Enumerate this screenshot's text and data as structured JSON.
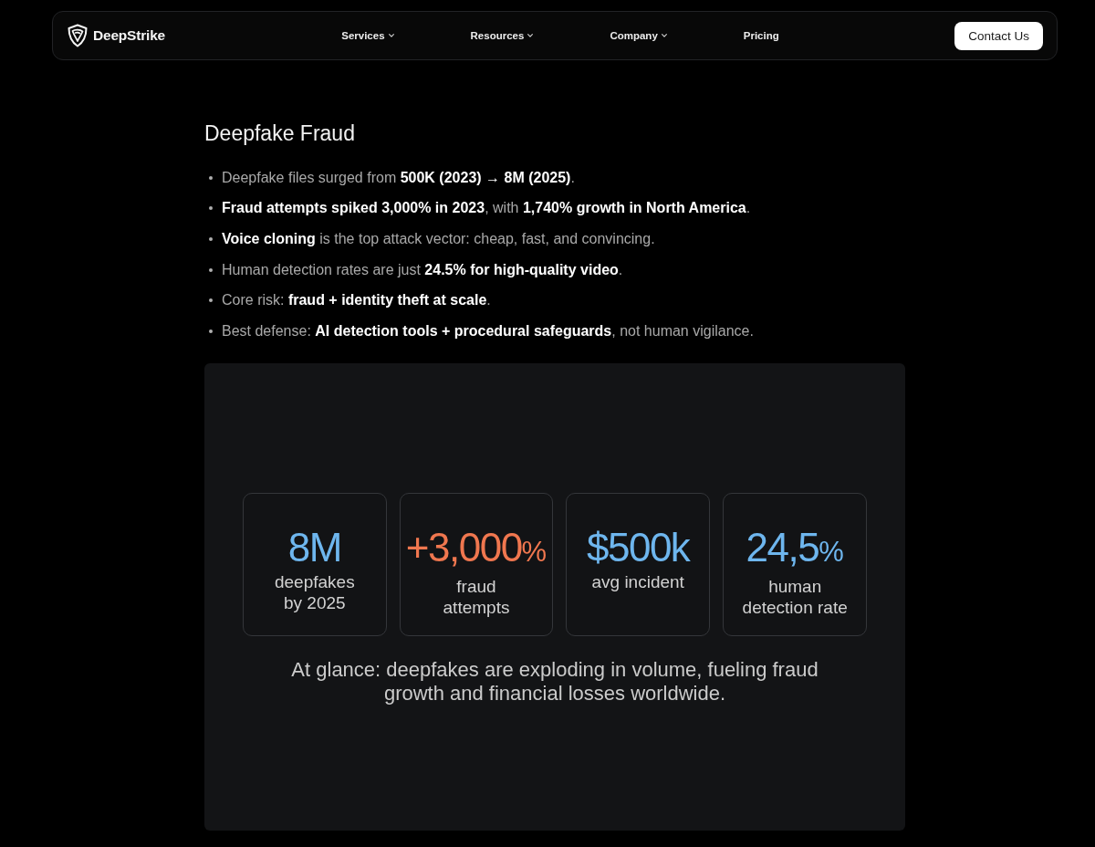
{
  "nav": {
    "brand": "DeepStrike",
    "links": [
      {
        "label": "Services",
        "dropdown": true
      },
      {
        "label": "Resources",
        "dropdown": true
      },
      {
        "label": "Company",
        "dropdown": true
      },
      {
        "label": "Pricing",
        "dropdown": false
      }
    ],
    "cta": "Contact Us"
  },
  "article": {
    "title": "Deepfake Fraud",
    "bullets": [
      "Deepfake files surged from **500K (2023) → 8M (2025)**.",
      "**Fraud attempts spiked 3,000% in 2023**, with **1,740% growth in North America**.",
      "**Voice cloning** is the top attack vector: cheap, fast, and convincing.",
      "Human detection rates are just **24.5% for high-quality video**.",
      "Core risk: **fraud + identity theft at scale**.",
      "Best defense: **AI detection tools + procedural safeguards**, not human vigilance."
    ]
  },
  "panel": {
    "stats": [
      {
        "value": "8M",
        "label": "deepfakes\nby 2025",
        "color": "#6eb6ee"
      },
      {
        "value": "+3,000",
        "unit": "%",
        "label": "fraud\nattempts",
        "color": "#f0774f"
      },
      {
        "value": "$500k",
        "label": "avg incident",
        "color": "#6eb6ee"
      },
      {
        "value": "24,5",
        "unit": "%",
        "label": "human\ndetection rate",
        "color": "#6eb6ee"
      }
    ],
    "caption": "At glance: deepfakes are exploding in volume, fueling fraud growth and financial losses worldwide."
  }
}
